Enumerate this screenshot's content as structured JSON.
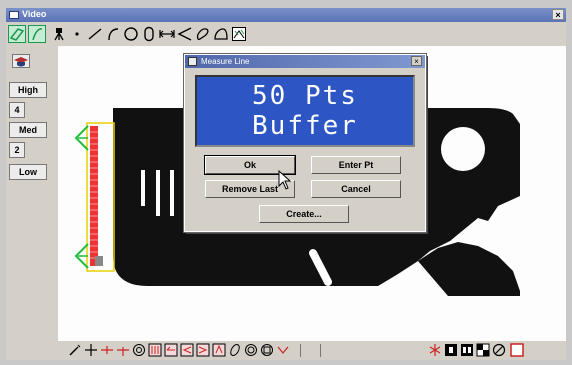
{
  "window": {
    "title": "Video"
  },
  "toolbar": {
    "tools": [
      "select-tool-icon",
      "measure-tool-icon",
      "tripod-icon",
      "point-tool-icon",
      "line-tool-icon",
      "arc-tool-icon",
      "circle-tool-icon",
      "slot-tool-icon",
      "distance-tool-icon",
      "angle-tool-icon",
      "curve-tool-icon",
      "profile-tool-icon",
      "image-tool-icon"
    ]
  },
  "left_panel": {
    "buttons": [
      {
        "label": "High"
      },
      {
        "label": "4"
      },
      {
        "label": "Med"
      },
      {
        "label": "2"
      },
      {
        "label": "Low"
      }
    ]
  },
  "dialog": {
    "title": "Measure Line",
    "display_line1": "50 Pts",
    "display_line2": "Buffer",
    "ok_label": "Ok",
    "enter_pt_label": "Enter Pt",
    "remove_last_label": "Remove Last",
    "cancel_label": "Cancel",
    "create_label": "Create..."
  },
  "colors": {
    "part": "#111111",
    "display_bg": "#2d55c4",
    "title_bar": "#5a73b6",
    "highlight": "#1a9a50"
  }
}
